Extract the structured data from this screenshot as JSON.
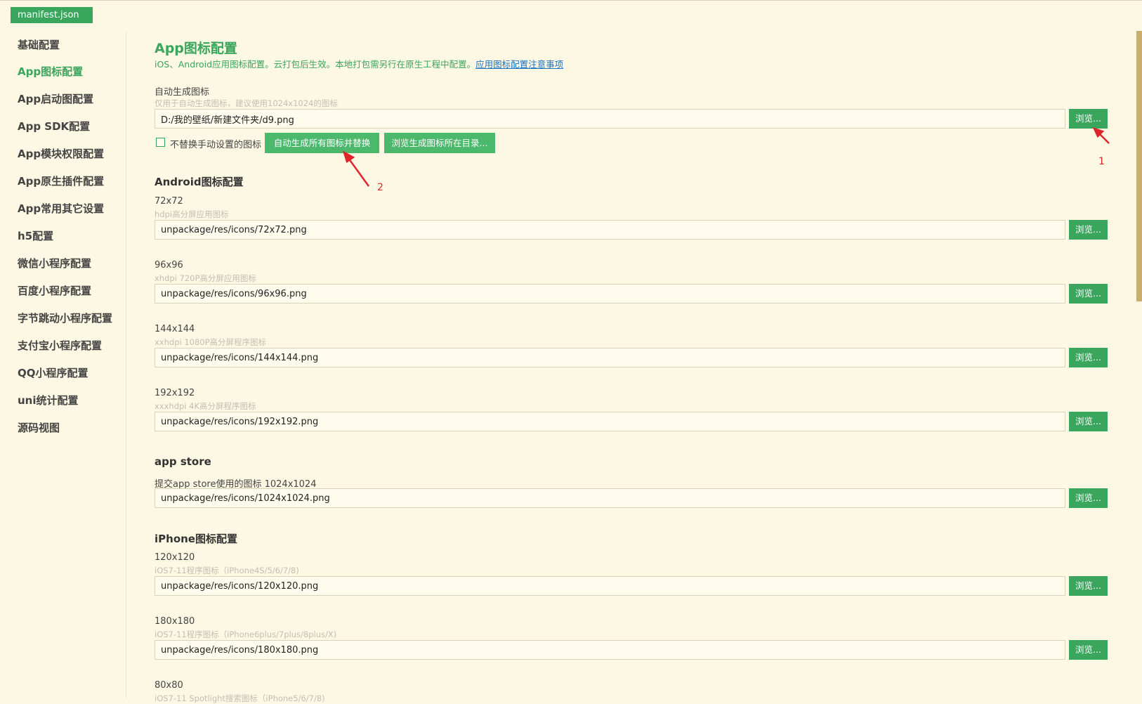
{
  "file_tab": "manifest.json",
  "sidebar": {
    "items": [
      {
        "label": "基础配置",
        "active": false
      },
      {
        "label": "App图标配置",
        "active": true
      },
      {
        "label": "App启动图配置",
        "active": false
      },
      {
        "label": "App SDK配置",
        "active": false
      },
      {
        "label": "App模块权限配置",
        "active": false
      },
      {
        "label": "App原生插件配置",
        "active": false
      },
      {
        "label": "App常用其它设置",
        "active": false
      },
      {
        "label": "h5配置",
        "active": false
      },
      {
        "label": "微信小程序配置",
        "active": false
      },
      {
        "label": "百度小程序配置",
        "active": false
      },
      {
        "label": "字节跳动小程序配置",
        "active": false
      },
      {
        "label": "支付宝小程序配置",
        "active": false
      },
      {
        "label": "QQ小程序配置",
        "active": false
      },
      {
        "label": "uni统计配置",
        "active": false
      },
      {
        "label": "源码视图",
        "active": false
      }
    ]
  },
  "main": {
    "title": "App图标配置",
    "description": "iOS、Android应用图标配置。云打包后生效。本地打包需另行在原生工程中配置。",
    "description_link": "应用图标配置注意事项",
    "browse_label": "浏览...",
    "auto": {
      "label": "自动生成图标",
      "hint": "仅用于自动生成图标，建议使用1024x1024的图标",
      "value": "D:/我的壁纸/新建文件夹/d9.png",
      "checkbox_label": "不替换手动设置的图标",
      "checkbox_checked": false,
      "generate_button": "自动生成所有图标并替换",
      "browse_dir_button": "浏览生成图标所在目录..."
    },
    "android": {
      "heading": "Android图标配置",
      "icons": [
        {
          "size": "72x72",
          "hint": "hdpi高分屏应用图标",
          "value": "unpackage/res/icons/72x72.png"
        },
        {
          "size": "96x96",
          "hint": "xhdpi 720P高分屏应用图标",
          "value": "unpackage/res/icons/96x96.png"
        },
        {
          "size": "144x144",
          "hint": "xxhdpi 1080P高分屏程序图标",
          "value": "unpackage/res/icons/144x144.png"
        },
        {
          "size": "192x192",
          "hint": "xxxhdpi 4K高分屏程序图标",
          "value": "unpackage/res/icons/192x192.png"
        }
      ]
    },
    "appstore": {
      "heading": "app store",
      "label": "提交app store使用的图标 1024x1024",
      "value": "unpackage/res/icons/1024x1024.png"
    },
    "iphone": {
      "heading": "iPhone图标配置",
      "icons": [
        {
          "size": "120x120",
          "hint": "iOS7-11程序图标（iPhone4S/5/6/7/8)",
          "value": "unpackage/res/icons/120x120.png"
        },
        {
          "size": "180x180",
          "hint": "iOS7-11程序图标（iPhone6plus/7plus/8plus/X)",
          "value": "unpackage/res/icons/180x180.png"
        },
        {
          "size": "80x80",
          "hint": "iOS7-11 Spotlight搜索图标（iPhone5/6/7/8)"
        }
      ]
    }
  },
  "annotations": {
    "marker_1": "1",
    "marker_2": "2",
    "color": "#e0242b"
  },
  "colors": {
    "accent": "#3aa55d",
    "background": "#fdf8e3",
    "link": "#1a73c4"
  }
}
